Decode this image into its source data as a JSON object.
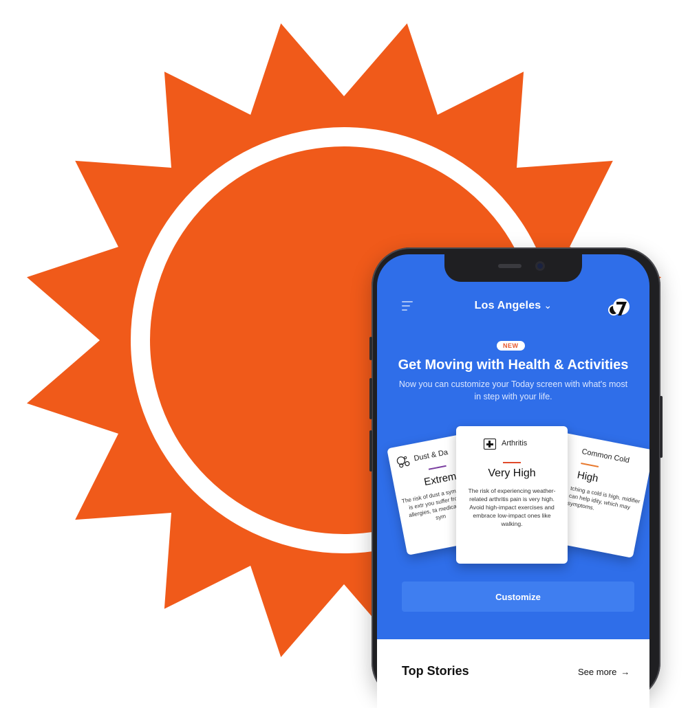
{
  "logo": {
    "name": "sun-logo",
    "color": "#f05a1a"
  },
  "app": {
    "header": {
      "location": "Los Angeles",
      "menu_icon": "hamburger-icon",
      "chevron_icon": "chevron-down-icon",
      "station_logo": "abc7-logo"
    },
    "promo": {
      "badge": "NEW",
      "headline": "Get Moving with Health & Activities",
      "subtext": "Now you can customize your Today screen with what's most in step with your life."
    },
    "cards": {
      "left": {
        "icon": "dust-dander-icon",
        "title": "Dust & Da",
        "level": "Extrem",
        "rule_color": "#7b3fa0",
        "body": "The risk of dust a symptoms is extr you suffer from d allergies, ta medication c sym"
      },
      "center": {
        "icon": "first-aid-icon",
        "title": "Arthritis",
        "level": "Very High",
        "rule_color": "#e04a2a",
        "body": "The risk of experiencing weather-related arthritis pain is very high. Avoid high-impact exercises and embrace low-impact ones like walking."
      },
      "right": {
        "icon": "cold-icon",
        "title": "Common Cold",
        "level": "High",
        "rule_color": "#e8792e",
        "body": "tching a cold is high. midifier can help idity, which may symptoms."
      }
    },
    "customize_label": "Customize",
    "top_stories": {
      "title": "Top Stories",
      "see_more": "See more",
      "arrow": "→"
    }
  }
}
